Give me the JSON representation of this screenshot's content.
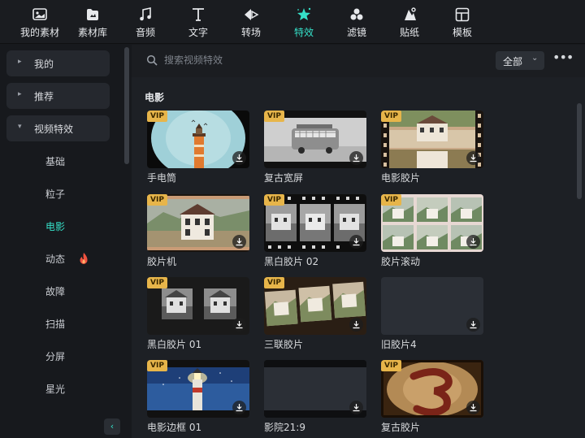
{
  "toolbar": {
    "tabs": [
      {
        "label": "我的素材",
        "icon": "my-media-icon"
      },
      {
        "label": "素材库",
        "icon": "library-icon"
      },
      {
        "label": "音频",
        "icon": "music-note-icon"
      },
      {
        "label": "文字",
        "icon": "text-icon"
      },
      {
        "label": "转场",
        "icon": "transition-icon"
      },
      {
        "label": "特效",
        "icon": "effects-star-icon",
        "active": true
      },
      {
        "label": "滤镜",
        "icon": "filter-circles-icon"
      },
      {
        "label": "贴纸",
        "icon": "sticker-icon"
      },
      {
        "label": "模板",
        "icon": "template-icon"
      }
    ],
    "active_color": "#35e0c8"
  },
  "sidebar": {
    "groups": [
      {
        "label": "我的",
        "arrow": "▸"
      },
      {
        "label": "推荐",
        "arrow": "▸"
      },
      {
        "label": "视频特效",
        "arrow": "▾"
      }
    ],
    "subitems": [
      {
        "label": "基础"
      },
      {
        "label": "粒子"
      },
      {
        "label": "电影",
        "active": true
      },
      {
        "label": "动态",
        "badge": "fire-icon"
      },
      {
        "label": "故障"
      },
      {
        "label": "扫描"
      },
      {
        "label": "分屏"
      },
      {
        "label": "星光"
      }
    ],
    "collapse": "‹"
  },
  "search": {
    "placeholder": "搜索视频特效",
    "filter_value": "全部",
    "more": "•••"
  },
  "section": {
    "title": "电影"
  },
  "cards": [
    {
      "label": "手电筒",
      "vip": "VIP"
    },
    {
      "label": "复古宽屏",
      "vip": "VIP"
    },
    {
      "label": "电影胶片",
      "vip": "VIP"
    },
    {
      "label": "胶片机",
      "vip": "VIP"
    },
    {
      "label": "黑白胶片 02",
      "vip": "VIP"
    },
    {
      "label": "胶片滚动",
      "vip": "VIP"
    },
    {
      "label": "黑白胶片 01",
      "vip": "VIP"
    },
    {
      "label": "三联胶片",
      "vip": "VIP"
    },
    {
      "label": "旧胶片4",
      "vip": ""
    },
    {
      "label": "电影边框 01",
      "vip": "VIP"
    },
    {
      "label": "影院21:9",
      "vip": ""
    },
    {
      "label": "复古胶片",
      "vip": "VIP"
    }
  ]
}
